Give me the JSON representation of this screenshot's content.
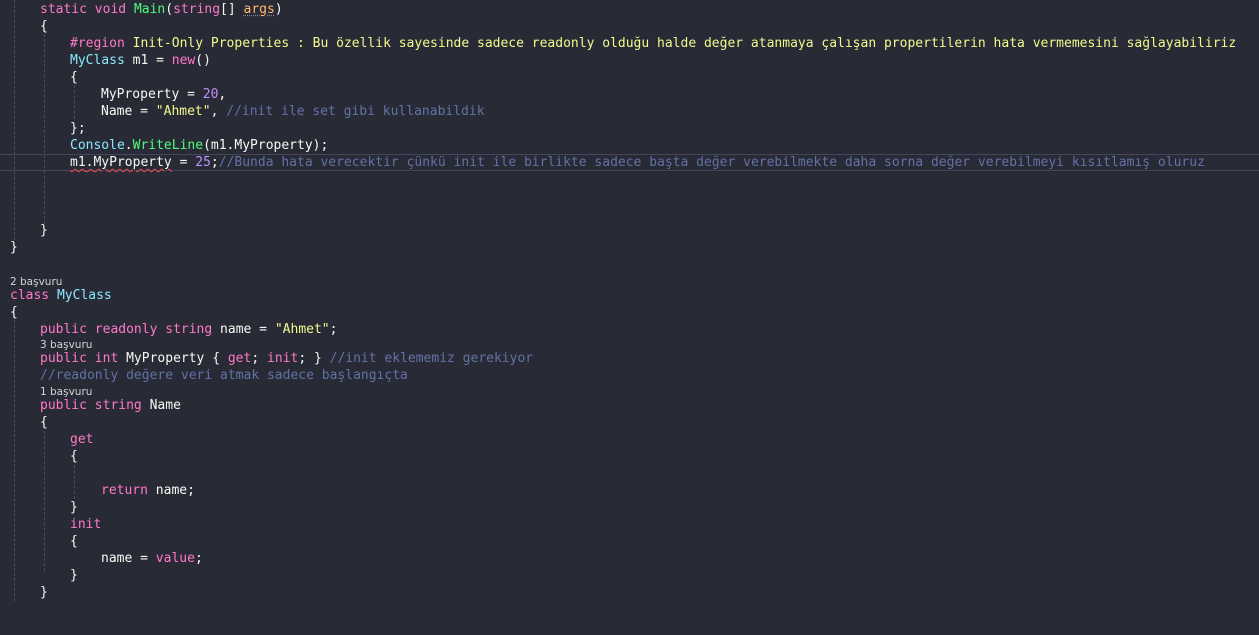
{
  "editor": {
    "lens": {
      "myclass_refs": "2 başvuru",
      "myproperty_refs": "3 başvuru",
      "name_refs": "1 başvuru"
    },
    "main": {
      "static": "static",
      "void": "void",
      "name": "Main",
      "params_open": "(",
      "param_type": "string",
      "brackets": "[] ",
      "param_name": "args",
      "params_close": ")",
      "open_brace": "{",
      "region_keyword": "#region",
      "region_text": " Init-Only Properties : Bu özellik sayesinde sadece readonly olduğu halde değer atanmaya çalışan propertilerin hata vermemesini sağlayabiliriz",
      "decl_type": "MyClass",
      "decl_var": " m1 = ",
      "decl_new": "new",
      "decl_parens": "()",
      "init_open": "{",
      "init_prop": "MyProperty = ",
      "init_prop_value": "20",
      "init_comma": ",",
      "init_name": "Name = ",
      "init_name_value": "\"Ahmet\"",
      "init_name_comma": ", ",
      "init_comment": "//init ile set gibi kullanabildik",
      "init_close": "};",
      "console_class": "Console",
      "console_dot": ".",
      "console_method": "WriteLine",
      "console_args": "(m1.MyProperty);",
      "assign_target_obj": "m1",
      "assign_dot": ".",
      "assign_target_prop": "MyProperty",
      "assign_eq": " = ",
      "assign_value": "25",
      "assign_semi": ";",
      "assign_comment": "//Bunda hata verecektir çünkü init ile birlikte sadece başta değer verebilmekte daha sorna değer verebilmeyi kısıtlamış oluruz",
      "close_brace_inner": "}",
      "close_brace_outer": "}"
    },
    "myclass": {
      "class_kw": "class",
      "class_name": "MyClass",
      "open_brace": "{",
      "field_public": "public",
      "field_readonly": "readonly",
      "field_type": "string",
      "field_name": " name = ",
      "field_value": "\"Ahmet\"",
      "field_semi": ";",
      "prop_public": "public",
      "prop_type": "int",
      "prop_name": " MyProperty { ",
      "prop_get": "get",
      "prop_sep": "; ",
      "prop_init": "init",
      "prop_end": "; } ",
      "prop_comment": "//init eklememiz gerekiyor",
      "readonly_comment": "//readonly değere veri atmak sadece başlangıçta",
      "name_public": "public",
      "name_type": "string",
      "name_name": " Name",
      "name_open": "{",
      "get_kw": "get",
      "get_open": "{",
      "return_kw": "return",
      "return_expr": " name;",
      "get_close": "}",
      "init_kw": "init",
      "init_open": "{",
      "assign_lhs": "name = ",
      "assign_value_kw": "value",
      "assign_semi": ";",
      "init_close": "}",
      "name_close": "}"
    }
  }
}
